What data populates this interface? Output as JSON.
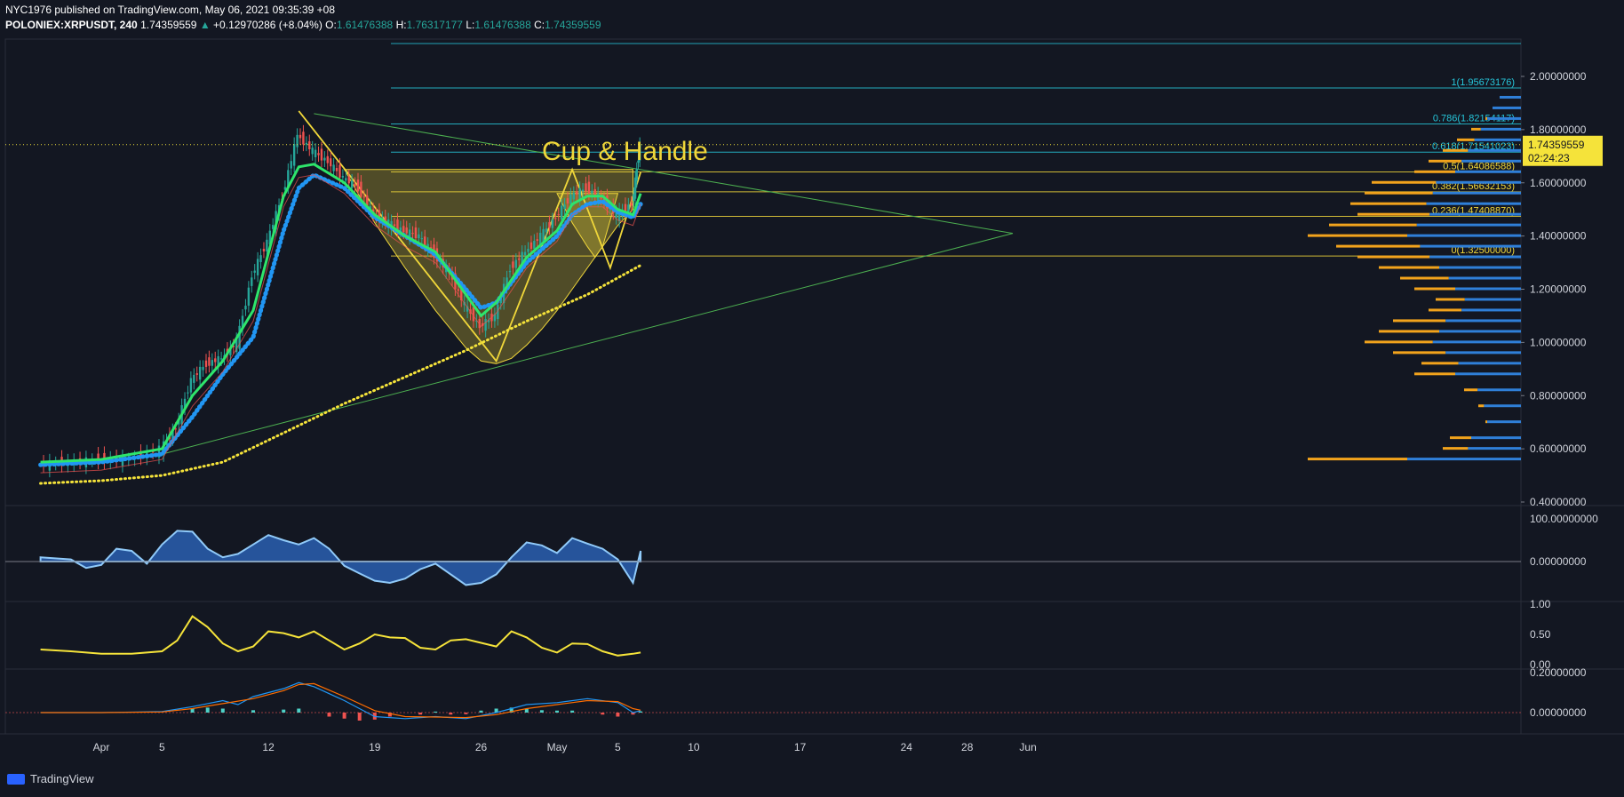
{
  "header": {
    "line1": "NYC1976 published on TradingView.com, May 06, 2021 09:35:39 +08",
    "symbol": "POLONIEX:XRPUSDT, 240",
    "last": "1.74359559",
    "change": "+0.12970286 (+8.04%)",
    "ohlc": {
      "o_label": "O:",
      "o": "1.61476388",
      "h_label": "H:",
      "h": "1.76317177",
      "l_label": "L:",
      "l": "1.61476388",
      "c_label": "C:",
      "c": "1.74359559"
    }
  },
  "footer": {
    "brand": "TradingView"
  },
  "colors": {
    "background": "#131722",
    "grid": "#1e2230",
    "up": "#26a69a",
    "down": "#ef5350",
    "ema_green": "#2ee56b",
    "ema_blue": "#2196f3",
    "ma_yellow": "#f5e33a",
    "fib": "#f0d73a",
    "fib_top": "#26c6da",
    "volume_profile_up": "#f2a31c",
    "volume_profile_down": "#2f7fd8",
    "price_tag": "#f5e33a"
  },
  "chart_data": [
    {
      "type": "line",
      "panel": "price",
      "annotation_text": "Cup & Handle",
      "price_tag": {
        "value": "1.74359559",
        "countdown": "02:24:23"
      },
      "y_ticks": [
        "2.00000000",
        "1.80000000",
        "1.60000000",
        "1.40000000",
        "1.20000000",
        "1.00000000",
        "0.80000000",
        "0.60000000",
        "0.40000000"
      ],
      "ylim": [
        0.4,
        2.1
      ],
      "x_ticks": [
        "Apr",
        "5",
        "12",
        "19",
        "26",
        "May",
        "5",
        "10",
        "17",
        "24",
        "28",
        "Jun"
      ],
      "x_tick_days": [
        0,
        4,
        11,
        18,
        25,
        30,
        34,
        39,
        46,
        53,
        57,
        61
      ],
      "fib_levels": [
        {
          "label": "1(1.95673176)",
          "value": 1.9567
        },
        {
          "label": "0.786(1.82154117)",
          "value": 1.8215
        },
        {
          "label": "0.618(1.71541023)",
          "value": 1.7154
        },
        {
          "label": "0.5(1.64086588)",
          "value": 1.6409
        },
        {
          "label": "0.382(1.56632153)",
          "value": 1.5663
        },
        {
          "label": "0.236(1.47408870)",
          "value": 1.4741
        },
        {
          "label": "0(1.32500000)",
          "value": 1.325
        }
      ],
      "price_series": [
        [
          -4,
          0.54
        ],
        [
          -2,
          0.55
        ],
        [
          0,
          0.56
        ],
        [
          2,
          0.56
        ],
        [
          4,
          0.6
        ],
        [
          5,
          0.68
        ],
        [
          6,
          0.86
        ],
        [
          7,
          0.92
        ],
        [
          8,
          0.94
        ],
        [
          9,
          1.0
        ],
        [
          10,
          1.25
        ],
        [
          11,
          1.38
        ],
        [
          12,
          1.55
        ],
        [
          13,
          1.78
        ],
        [
          14,
          1.72
        ],
        [
          15,
          1.68
        ],
        [
          16,
          1.62
        ],
        [
          17,
          1.58
        ],
        [
          18,
          1.48
        ],
        [
          19,
          1.45
        ],
        [
          20,
          1.42
        ],
        [
          21,
          1.4
        ],
        [
          22,
          1.33
        ],
        [
          23,
          1.26
        ],
        [
          24,
          1.14
        ],
        [
          25,
          1.06
        ],
        [
          26,
          1.1
        ],
        [
          27,
          1.28
        ],
        [
          28,
          1.34
        ],
        [
          29,
          1.4
        ],
        [
          30,
          1.47
        ],
        [
          31,
          1.55
        ],
        [
          32,
          1.58
        ],
        [
          33,
          1.54
        ],
        [
          34,
          1.48
        ],
        [
          35,
          1.52
        ],
        [
          35.5,
          1.74
        ]
      ],
      "ema_green": [
        [
          -4,
          0.55
        ],
        [
          0,
          0.56
        ],
        [
          4,
          0.6
        ],
        [
          6,
          0.8
        ],
        [
          8,
          0.93
        ],
        [
          10,
          1.12
        ],
        [
          12,
          1.55
        ],
        [
          13,
          1.66
        ],
        [
          14,
          1.67
        ],
        [
          16,
          1.6
        ],
        [
          18,
          1.48
        ],
        [
          20,
          1.4
        ],
        [
          22,
          1.34
        ],
        [
          24,
          1.18
        ],
        [
          25,
          1.1
        ],
        [
          26,
          1.15
        ],
        [
          28,
          1.32
        ],
        [
          30,
          1.42
        ],
        [
          31,
          1.52
        ],
        [
          32,
          1.55
        ],
        [
          33,
          1.55
        ],
        [
          34,
          1.5
        ],
        [
          35,
          1.48
        ],
        [
          35.5,
          1.56
        ]
      ],
      "ema_blue": [
        [
          -4,
          0.54
        ],
        [
          0,
          0.55
        ],
        [
          4,
          0.58
        ],
        [
          6,
          0.72
        ],
        [
          8,
          0.88
        ],
        [
          10,
          1.02
        ],
        [
          12,
          1.42
        ],
        [
          13,
          1.58
        ],
        [
          14,
          1.63
        ],
        [
          16,
          1.58
        ],
        [
          18,
          1.47
        ],
        [
          20,
          1.4
        ],
        [
          22,
          1.33
        ],
        [
          24,
          1.2
        ],
        [
          25,
          1.13
        ],
        [
          26,
          1.15
        ],
        [
          28,
          1.3
        ],
        [
          30,
          1.4
        ],
        [
          31,
          1.48
        ],
        [
          32,
          1.52
        ],
        [
          33,
          1.53
        ],
        [
          34,
          1.49
        ],
        [
          35,
          1.47
        ],
        [
          35.5,
          1.52
        ]
      ],
      "ma_yellow": [
        [
          -4,
          0.47
        ],
        [
          0,
          0.48
        ],
        [
          4,
          0.5
        ],
        [
          8,
          0.55
        ],
        [
          12,
          0.66
        ],
        [
          16,
          0.77
        ],
        [
          20,
          0.87
        ],
        [
          24,
          0.97
        ],
        [
          28,
          1.08
        ],
        [
          32,
          1.18
        ],
        [
          35.5,
          1.29
        ]
      ],
      "volume_profile": [
        [
          0.56,
          0.6
        ],
        [
          0.6,
          0.22
        ],
        [
          0.64,
          0.2
        ],
        [
          0.7,
          0.1
        ],
        [
          0.76,
          0.12
        ],
        [
          0.82,
          0.16
        ],
        [
          0.88,
          0.3
        ],
        [
          0.92,
          0.28
        ],
        [
          0.96,
          0.36
        ],
        [
          1.0,
          0.44
        ],
        [
          1.04,
          0.4
        ],
        [
          1.08,
          0.36
        ],
        [
          1.12,
          0.26
        ],
        [
          1.16,
          0.24
        ],
        [
          1.2,
          0.3
        ],
        [
          1.24,
          0.34
        ],
        [
          1.28,
          0.4
        ],
        [
          1.32,
          0.46
        ],
        [
          1.36,
          0.52
        ],
        [
          1.4,
          0.6
        ],
        [
          1.44,
          0.54
        ],
        [
          1.48,
          0.46
        ],
        [
          1.52,
          0.48
        ],
        [
          1.56,
          0.44
        ],
        [
          1.6,
          0.42
        ],
        [
          1.64,
          0.3
        ],
        [
          1.68,
          0.26
        ],
        [
          1.72,
          0.22
        ],
        [
          1.76,
          0.18
        ],
        [
          1.8,
          0.14
        ],
        [
          1.84,
          0.1
        ],
        [
          1.88,
          0.08
        ],
        [
          1.92,
          0.06
        ]
      ]
    },
    {
      "type": "area",
      "panel": "oscillator",
      "y_ticks": [
        "100.00000000",
        "0.00000000"
      ],
      "ylim": [
        -75,
        100
      ],
      "series": [
        [
          -4,
          10
        ],
        [
          -2,
          5
        ],
        [
          -1,
          -15
        ],
        [
          0,
          -8
        ],
        [
          1,
          30
        ],
        [
          2,
          25
        ],
        [
          3,
          -5
        ],
        [
          4,
          40
        ],
        [
          5,
          72
        ],
        [
          6,
          70
        ],
        [
          7,
          30
        ],
        [
          8,
          10
        ],
        [
          9,
          18
        ],
        [
          10,
          40
        ],
        [
          11,
          62
        ],
        [
          12,
          50
        ],
        [
          13,
          40
        ],
        [
          14,
          55
        ],
        [
          15,
          30
        ],
        [
          16,
          -10
        ],
        [
          17,
          -28
        ],
        [
          18,
          -45
        ],
        [
          19,
          -50
        ],
        [
          20,
          -40
        ],
        [
          21,
          -18
        ],
        [
          22,
          -5
        ],
        [
          23,
          -30
        ],
        [
          24,
          -55
        ],
        [
          25,
          -50
        ],
        [
          26,
          -30
        ],
        [
          27,
          10
        ],
        [
          28,
          45
        ],
        [
          29,
          38
        ],
        [
          30,
          20
        ],
        [
          31,
          55
        ],
        [
          32,
          42
        ],
        [
          33,
          30
        ],
        [
          34,
          5
        ],
        [
          35,
          -50
        ],
        [
          35.5,
          25
        ]
      ]
    },
    {
      "type": "line",
      "panel": "volatility",
      "y_ticks": [
        "1.00",
        "0.50",
        "0.00"
      ],
      "ylim": [
        0,
        1
      ],
      "series": [
        [
          -4,
          0.25
        ],
        [
          -2,
          0.22
        ],
        [
          0,
          0.18
        ],
        [
          2,
          0.18
        ],
        [
          4,
          0.22
        ],
        [
          5,
          0.4
        ],
        [
          6,
          0.8
        ],
        [
          7,
          0.62
        ],
        [
          8,
          0.35
        ],
        [
          9,
          0.22
        ],
        [
          10,
          0.3
        ],
        [
          11,
          0.55
        ],
        [
          12,
          0.52
        ],
        [
          13,
          0.45
        ],
        [
          14,
          0.55
        ],
        [
          15,
          0.4
        ],
        [
          16,
          0.25
        ],
        [
          17,
          0.35
        ],
        [
          18,
          0.5
        ],
        [
          19,
          0.45
        ],
        [
          20,
          0.44
        ],
        [
          21,
          0.28
        ],
        [
          22,
          0.25
        ],
        [
          23,
          0.4
        ],
        [
          24,
          0.42
        ],
        [
          25,
          0.36
        ],
        [
          26,
          0.3
        ],
        [
          27,
          0.55
        ],
        [
          28,
          0.45
        ],
        [
          29,
          0.28
        ],
        [
          30,
          0.2
        ],
        [
          31,
          0.35
        ],
        [
          32,
          0.34
        ],
        [
          33,
          0.22
        ],
        [
          34,
          0.15
        ],
        [
          35,
          0.18
        ],
        [
          35.5,
          0.2
        ]
      ]
    },
    {
      "type": "bar",
      "panel": "macd",
      "y_ticks": [
        "0.20000000",
        "0.00000000"
      ],
      "ylim": [
        -0.08,
        0.2
      ],
      "macd_line": [
        [
          -4,
          0.0
        ],
        [
          0,
          0.0
        ],
        [
          4,
          0.005
        ],
        [
          6,
          0.03
        ],
        [
          8,
          0.06
        ],
        [
          9,
          0.04
        ],
        [
          10,
          0.08
        ],
        [
          12,
          0.12
        ],
        [
          13,
          0.15
        ],
        [
          14,
          0.13
        ],
        [
          16,
          0.06
        ],
        [
          18,
          -0.02
        ],
        [
          20,
          -0.03
        ],
        [
          22,
          -0.02
        ],
        [
          24,
          -0.03
        ],
        [
          26,
          0.0
        ],
        [
          28,
          0.04
        ],
        [
          30,
          0.05
        ],
        [
          32,
          0.07
        ],
        [
          34,
          0.05
        ],
        [
          35,
          0.0
        ],
        [
          35.5,
          0.01
        ]
      ],
      "signal_line": [
        [
          -4,
          0.0
        ],
        [
          0,
          0.0
        ],
        [
          4,
          0.003
        ],
        [
          6,
          0.02
        ],
        [
          8,
          0.045
        ],
        [
          10,
          0.07
        ],
        [
          12,
          0.11
        ],
        [
          13,
          0.14
        ],
        [
          14,
          0.145
        ],
        [
          16,
          0.08
        ],
        [
          18,
          0.01
        ],
        [
          20,
          -0.02
        ],
        [
          22,
          -0.022
        ],
        [
          24,
          -0.025
        ],
        [
          26,
          -0.01
        ],
        [
          28,
          0.02
        ],
        [
          30,
          0.04
        ],
        [
          32,
          0.06
        ],
        [
          34,
          0.055
        ],
        [
          35,
          0.02
        ],
        [
          35.5,
          0.012
        ]
      ],
      "histogram": [
        [
          6,
          0.02
        ],
        [
          7,
          0.025
        ],
        [
          8,
          0.02
        ],
        [
          10,
          0.012
        ],
        [
          12,
          0.015
        ],
        [
          13,
          0.02
        ],
        [
          15,
          -0.02
        ],
        [
          16,
          -0.03
        ],
        [
          17,
          -0.04
        ],
        [
          18,
          -0.035
        ],
        [
          19,
          -0.02
        ],
        [
          21,
          -0.01
        ],
        [
          22,
          0.005
        ],
        [
          23,
          -0.01
        ],
        [
          24,
          -0.008
        ],
        [
          25,
          0.01
        ],
        [
          26,
          0.02
        ],
        [
          27,
          0.025
        ],
        [
          28,
          0.02
        ],
        [
          29,
          0.012
        ],
        [
          30,
          0.01
        ],
        [
          31,
          0.01
        ],
        [
          33,
          -0.01
        ],
        [
          34,
          -0.02
        ],
        [
          35,
          -0.01
        ],
        [
          35.5,
          0.006
        ]
      ]
    }
  ]
}
